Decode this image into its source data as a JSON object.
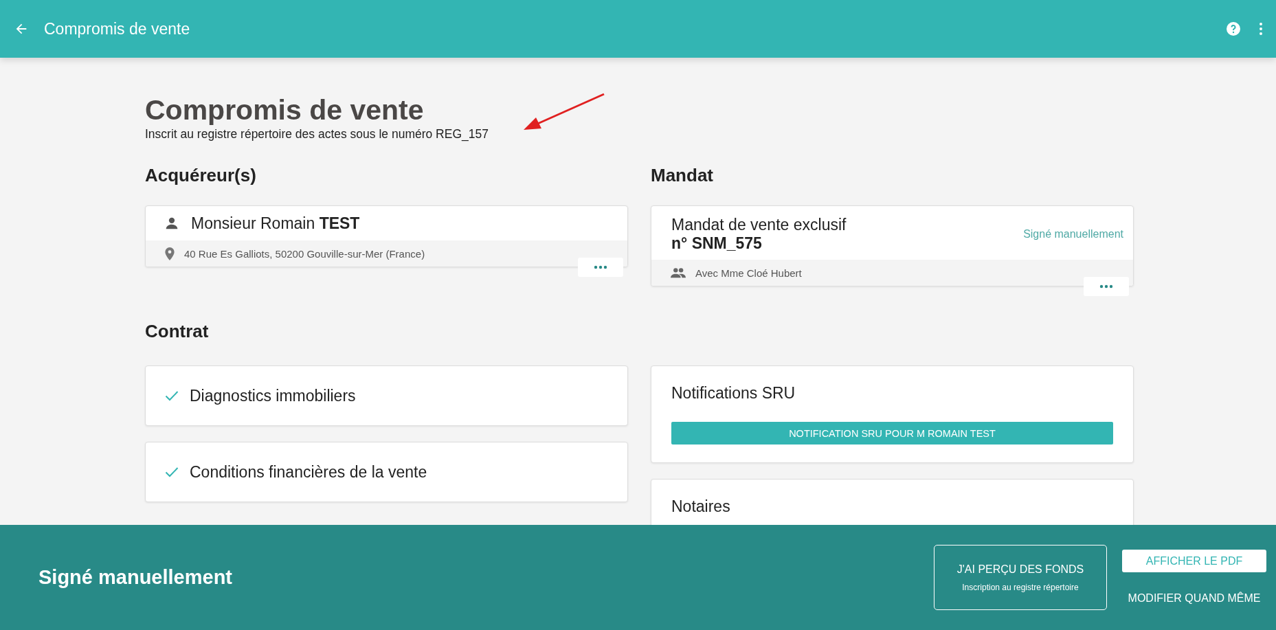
{
  "app_bar": {
    "title": "Compromis de vente"
  },
  "page": {
    "title": "Compromis de vente",
    "subtitle": "Inscrit au registre répertoire des actes sous le numéro REG_157"
  },
  "acquereurs": {
    "heading": "Acquéreur(s)",
    "cards": [
      {
        "civility": "Monsieur Romain ",
        "surname": "TEST",
        "address": "40 Rue Es Galliots, 50200 Gouville-sur-Mer (France)"
      }
    ]
  },
  "mandat": {
    "heading": "Mandat",
    "title": "Mandat de vente exclusif",
    "number": "n° SNM_575",
    "status": "Signé manuellement",
    "agent": "Avec Mme Cloé Hubert"
  },
  "contrat": {
    "heading": "Contrat",
    "items": [
      {
        "label": "Diagnostics immobiliers",
        "checked": true
      },
      {
        "label": "Conditions financières de la vente",
        "checked": true
      }
    ]
  },
  "panels": [
    {
      "title": "Notifications SRU",
      "buttons": [
        "NOTIFICATION SRU POUR M ROMAIN TEST"
      ]
    },
    {
      "title": "Notaires"
    }
  ],
  "footer": {
    "status": "Signé manuellement",
    "primary": {
      "label": "J'AI PERÇU DES FONDS",
      "sub": "Inscription au registre répertoire"
    },
    "pdf": "AFFICHER LE PDF",
    "modify": "MODIFIER QUAND MÊME"
  }
}
